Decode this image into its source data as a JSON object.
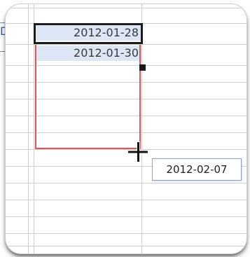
{
  "cells": {
    "a1": "2012-01-28",
    "a2": "2012-01-30"
  },
  "tooltip": {
    "value": "2012-02-07"
  },
  "left_clip": {
    "text": "D"
  }
}
